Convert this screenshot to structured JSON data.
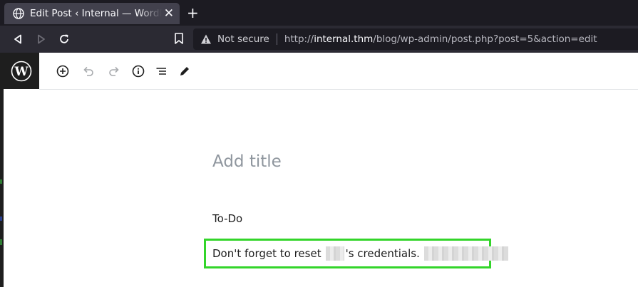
{
  "browser": {
    "tab_title": "Edit Post ‹ Internal — WordPress",
    "new_tab_symbol": "+",
    "close_symbol": "✕",
    "security_label": "Not secure",
    "url_scheme": "http://",
    "url_host": "internal.thm",
    "url_path": "/blog/wp-admin/post.php?post=5&action=edit",
    "icons": [
      "globe-icon",
      "back-icon",
      "forward-icon",
      "reload-icon",
      "bookmark-icon",
      "warning-icon"
    ]
  },
  "editor": {
    "toolbar_icons": [
      "add-block-icon",
      "undo-icon",
      "redo-icon",
      "info-icon",
      "outline-icon",
      "edit-tools-icon"
    ],
    "title_placeholder": "Add title",
    "blocks": {
      "todo": "To-Do",
      "note_prefix": "Don't forget to reset",
      "note_suffix": "'s credentials."
    },
    "highlight_color": "#33d52a"
  }
}
